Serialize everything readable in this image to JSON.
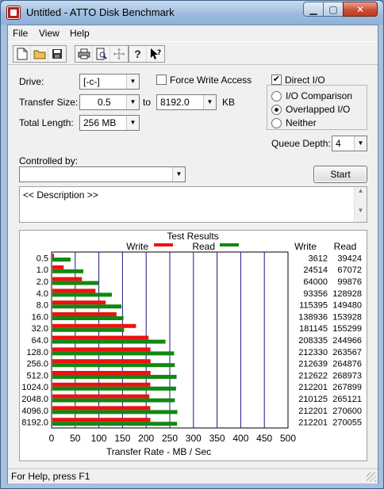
{
  "window": {
    "title": "Untitled - ATTO Disk Benchmark"
  },
  "menu": [
    "File",
    "View",
    "Help"
  ],
  "toolbar": {
    "icons": [
      "new-file-icon",
      "open-folder-icon",
      "save-icon",
      "print-icon",
      "print-preview-icon",
      "move-icon",
      "help-icon",
      "context-help-icon"
    ]
  },
  "form": {
    "drive_label": "Drive:",
    "drive_value": "[-c-]",
    "force_write_label": "Force Write Access",
    "force_write_checked": false,
    "direct_io_label": "Direct I/O",
    "direct_io_checked": true,
    "transfer_size_label": "Transfer Size:",
    "transfer_from": "0.5",
    "to_label": "to",
    "transfer_to": "8192.0",
    "kb_label": "KB",
    "total_length_label": "Total Length:",
    "total_length_value": "256 MB",
    "io_options": [
      "I/O Comparison",
      "Overlapped I/O",
      "Neither"
    ],
    "io_selected": "Overlapped I/O",
    "queue_depth_label": "Queue Depth:",
    "queue_depth_value": "4",
    "controlled_by_label": "Controlled by:",
    "controlled_by_value": "",
    "start_label": "Start",
    "description": "<< Description >>"
  },
  "results": {
    "title": "Test Results",
    "legend_write": "Write",
    "legend_read": "Read",
    "col_write": "Write",
    "col_read": "Read",
    "write_color": "#ee1111",
    "read_color": "#118811",
    "xlabel": "Transfer Rate - MB / Sec",
    "xticks": [
      "0",
      "50",
      "100",
      "150",
      "200",
      "250",
      "300",
      "350",
      "400",
      "450",
      "500"
    ],
    "xmax": 500
  },
  "chart_data": {
    "type": "bar",
    "orientation": "horizontal",
    "title": "Test Results",
    "xlabel": "Transfer Rate - MB / Sec",
    "xlim": [
      0,
      500
    ],
    "categories": [
      "0.5",
      "1.0",
      "2.0",
      "4.0",
      "8.0",
      "16.0",
      "32.0",
      "64.0",
      "128.0",
      "256.0",
      "512.0",
      "1024.0",
      "2048.0",
      "4096.0",
      "8192.0"
    ],
    "series": [
      {
        "name": "Write",
        "values": [
          3.5,
          23.9,
          62.5,
          91.2,
          112.7,
          135.7,
          176.9,
          203.5,
          207.4,
          207.7,
          207.6,
          207.2,
          205.2,
          207.2,
          207.2
        ]
      },
      {
        "name": "Read",
        "values": [
          38.5,
          65.5,
          97.5,
          125.9,
          146.0,
          150.3,
          151.7,
          239.2,
          257.4,
          258.7,
          262.7,
          261.6,
          259.0,
          264.3,
          263.7
        ]
      }
    ],
    "table_write": [
      "3612",
      "24514",
      "64000",
      "93356",
      "115395",
      "138936",
      "181145",
      "208335",
      "212330",
      "212639",
      "212622",
      "212201",
      "210125",
      "212201",
      "212201"
    ],
    "table_read": [
      "39424",
      "67072",
      "99876",
      "128928",
      "149480",
      "153928",
      "155299",
      "244966",
      "263567",
      "264876",
      "268973",
      "267899",
      "265121",
      "270600",
      "270055"
    ]
  },
  "status": {
    "text": "For Help, press F1"
  }
}
